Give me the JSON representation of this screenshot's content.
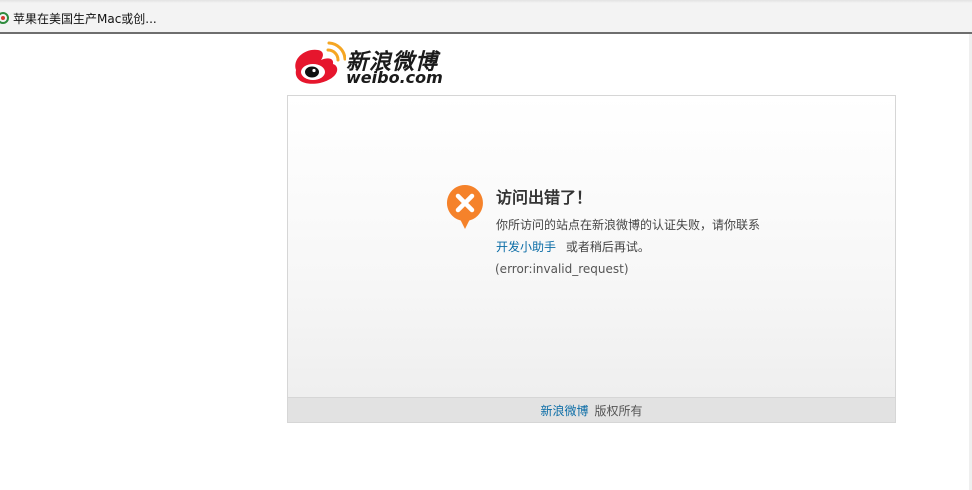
{
  "bookmarks_bar": {
    "items": [
      {
        "label": "苹果在美国生产Mac或创..."
      }
    ]
  },
  "logo": {
    "name_cn": "新浪微博",
    "name_en": "weibo.com"
  },
  "error": {
    "title": "访问出错了！",
    "message_line1": "你所访问的站点在新浪微博的认证失败，请你联系",
    "contact_link": "开发小助手",
    "message_line2_suffix": "或者稍后再试。",
    "code": "(error:invalid_request)"
  },
  "footer": {
    "brand_link": "新浪微博",
    "rights": "版权所有"
  },
  "colors": {
    "link": "#0a6ca6",
    "error_icon": "#f5822a",
    "logo_red": "#e6162d",
    "logo_yellow": "#f5a623"
  }
}
